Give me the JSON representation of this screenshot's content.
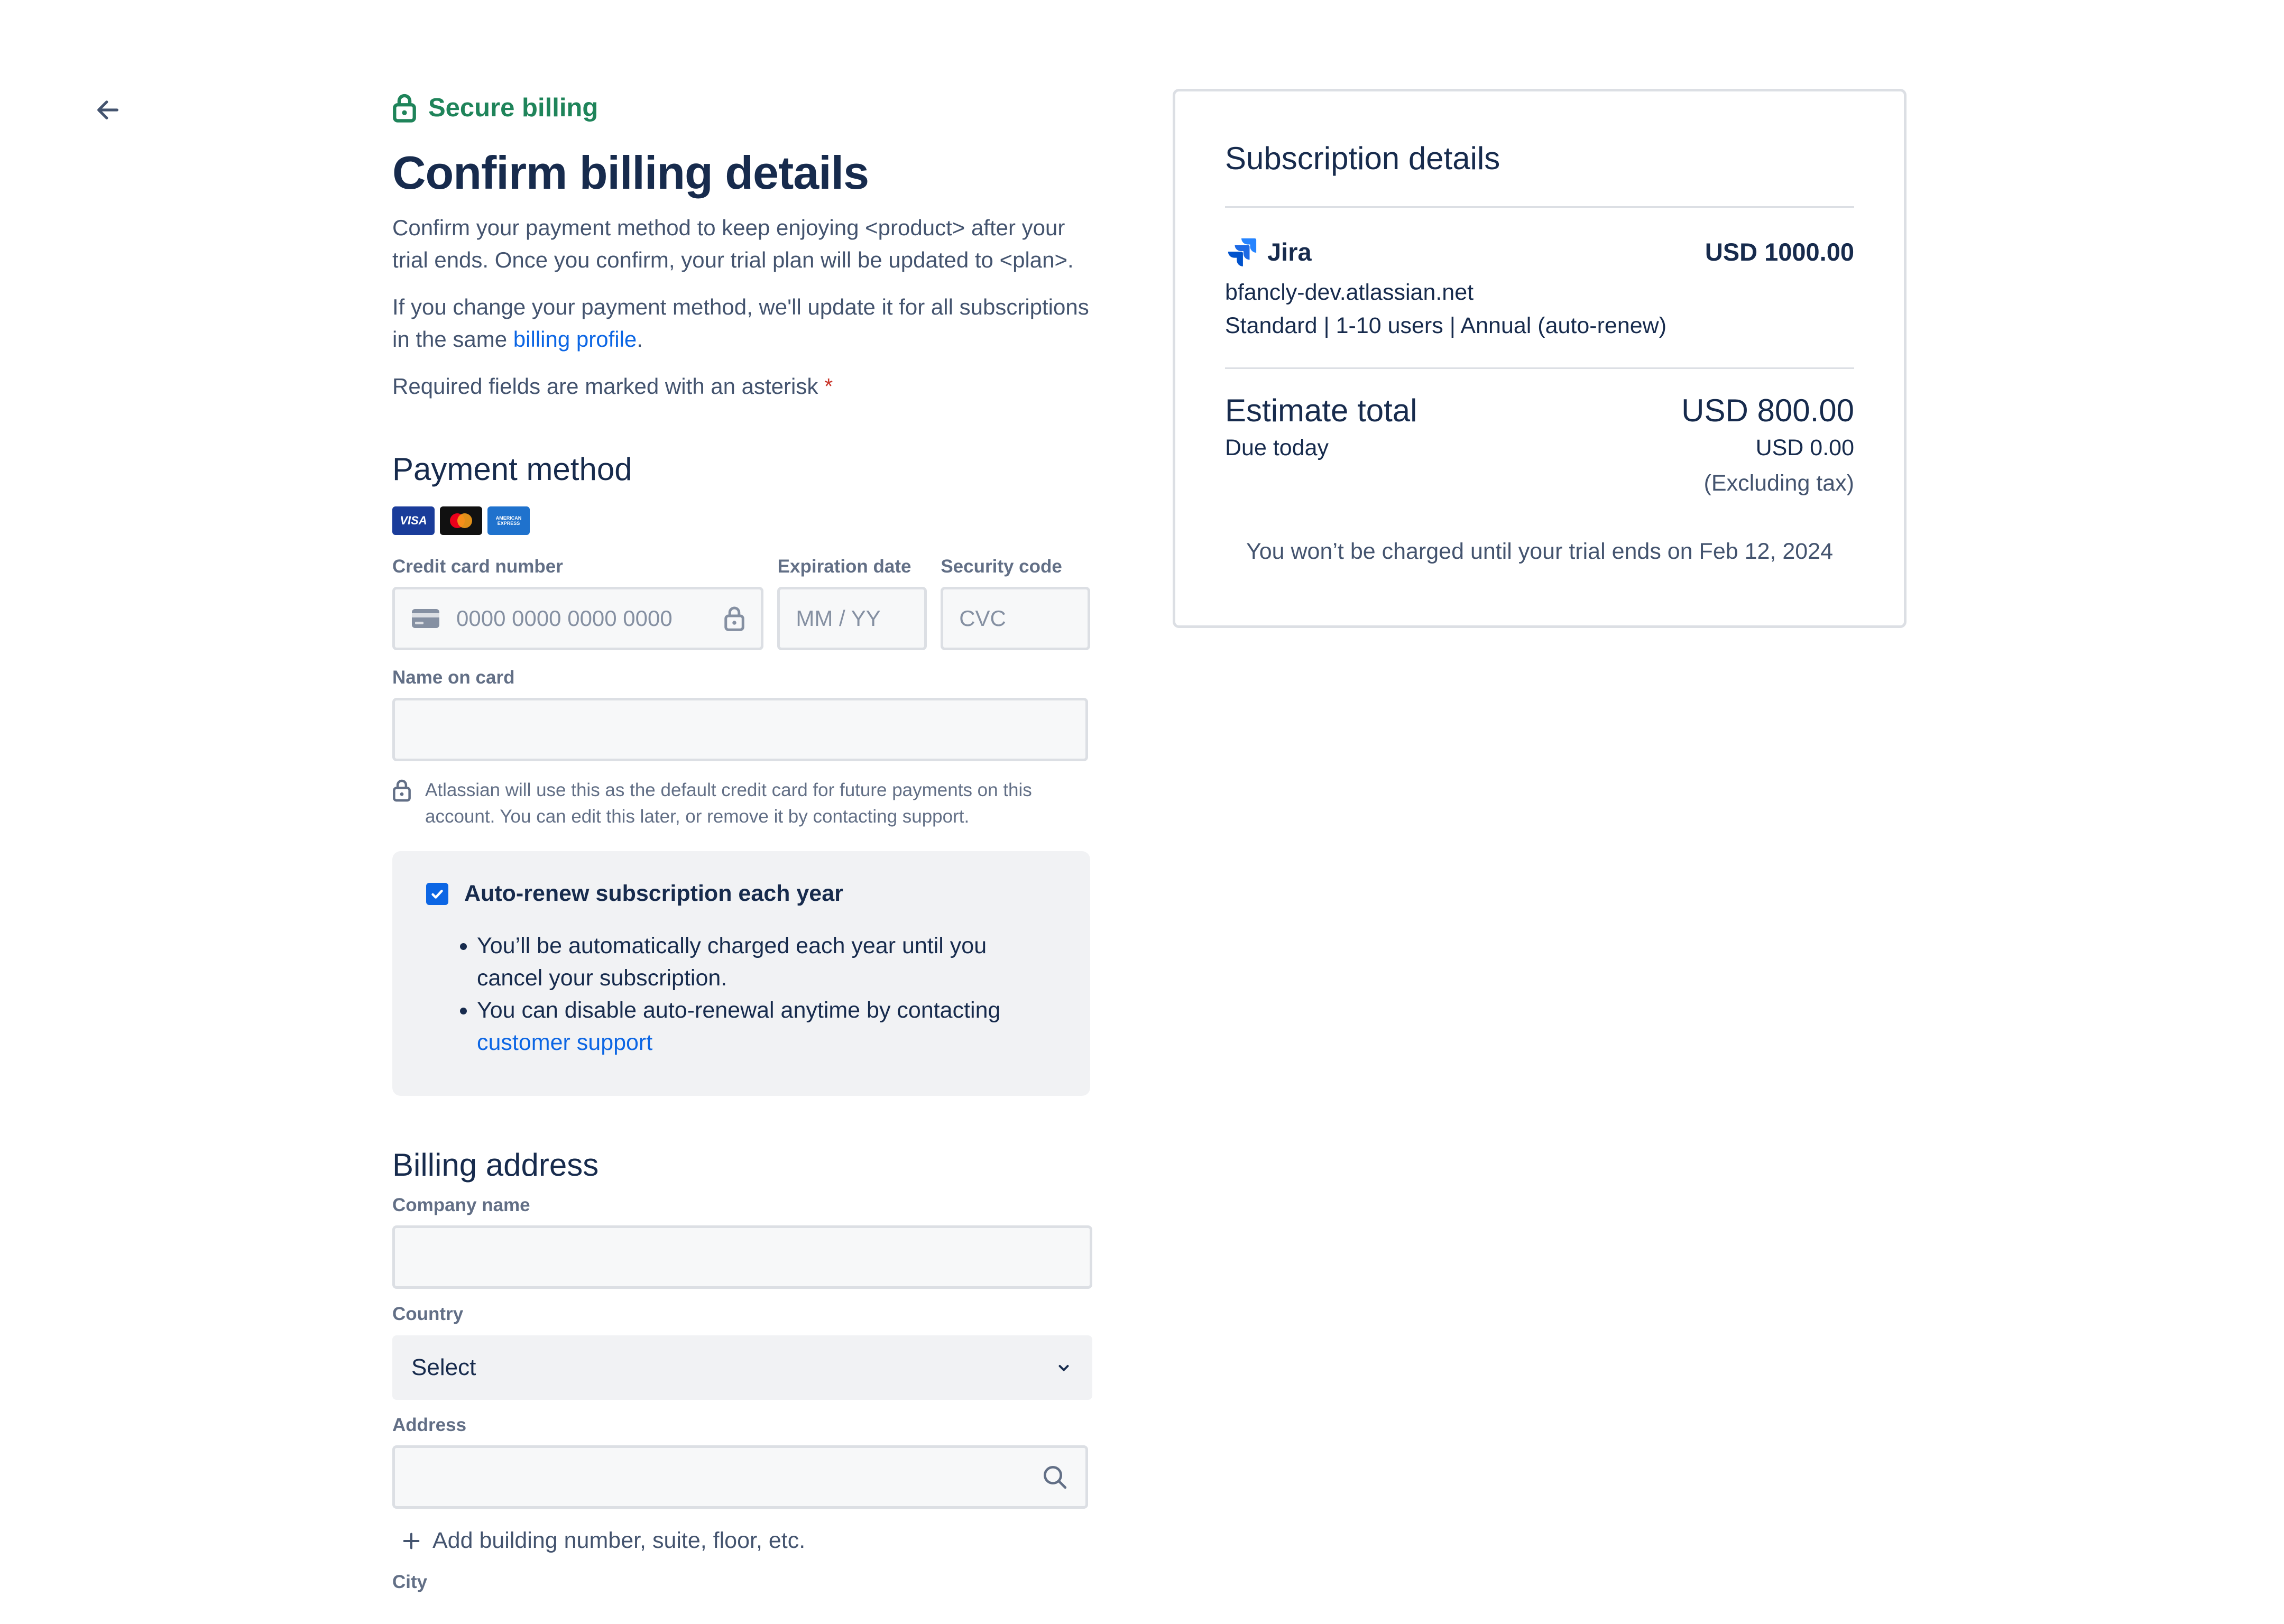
{
  "header": {
    "secure_label": "Secure billing",
    "title": "Confirm billing details",
    "intro": "Confirm your payment method to keep enjoying <product> after your trial ends. Once you confirm, your trial plan will be updated to <plan>.",
    "change_note_prefix": "If you change your payment method, we'll update it for all subscriptions in the same ",
    "change_note_link": "billing profile",
    "change_note_suffix": ".",
    "required_note": "Required fields are marked with an asterisk",
    "required_mark": "*"
  },
  "payment": {
    "title": "Payment method",
    "card_brands": [
      "VISA",
      "Mastercard",
      "American Express"
    ],
    "card_number_label": "Credit card number",
    "card_number_placeholder": "0000 0000 0000 0000",
    "expiration_label": "Expiration date",
    "expiration_placeholder": "MM / YY",
    "security_label": "Security code",
    "security_placeholder": "CVC",
    "name_label": "Name on card",
    "name_value": "",
    "notice": "Atlassian will use this as the default credit card for future payments on this account. You can edit this later, or remove it by contacting support."
  },
  "renewal": {
    "checkbox_label": "Auto-renew subscription each year",
    "checked": true,
    "bullet1": "You’ll be automatically charged each year until you cancel your subscription.",
    "bullet2_prefix": "You can disable auto-renewal anytime by contacting ",
    "bullet2_link": "customer support"
  },
  "billing_address": {
    "title": "Billing address",
    "company_label": "Company name",
    "company_value": "",
    "country_label": "Country",
    "country_value": "Select",
    "address_label": "Address",
    "address_value": "",
    "add_line_label": "Add building number, suite, floor, etc.",
    "city_label": "City"
  },
  "summary": {
    "title": "Subscription details",
    "product_name": "Jira",
    "product_price": "USD 1000.00",
    "site": "bfancly-dev.atlassian.net",
    "plan": "Standard | 1-10 users | Annual (auto-renew)",
    "estimate_label": "Estimate total",
    "estimate_value": "USD 800.00",
    "due_label": "Due today",
    "due_value": "USD 0.00",
    "tax_note": "(Excluding tax)",
    "charge_note": "You won’t be charged until your trial ends on Feb 12, 2024"
  },
  "colors": {
    "accent": "#0c66e4",
    "secure_green": "#1f845a",
    "text": "#172b4d",
    "required": "#c9372c"
  }
}
